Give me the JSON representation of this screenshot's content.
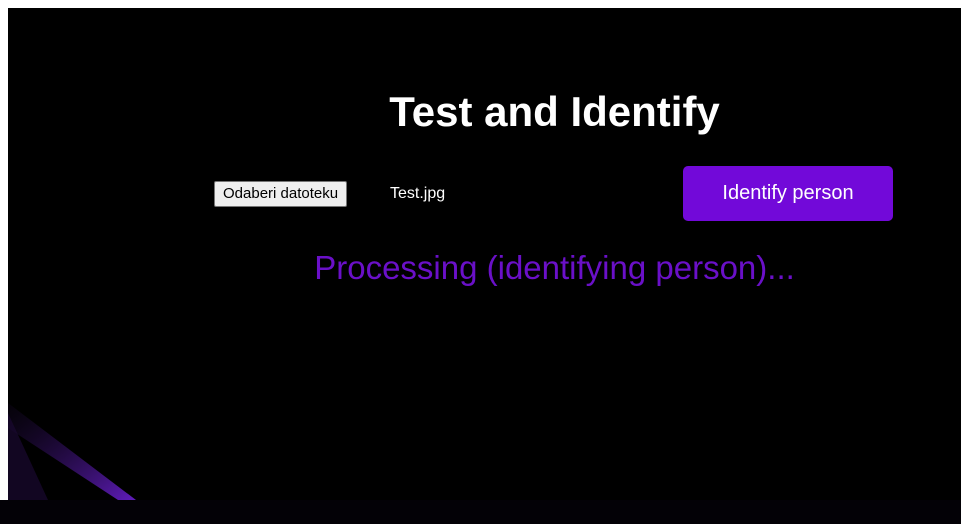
{
  "page": {
    "title": "Test and Identify"
  },
  "upload": {
    "button_label": "Odaberi datoteku",
    "file_name": "Test.jpg"
  },
  "actions": {
    "identify_label": "Identify person"
  },
  "status": {
    "message": "Processing (identifying person)..."
  },
  "colors": {
    "background": "#000000",
    "accent": "#7209d9",
    "status_text": "#6a10c8"
  }
}
